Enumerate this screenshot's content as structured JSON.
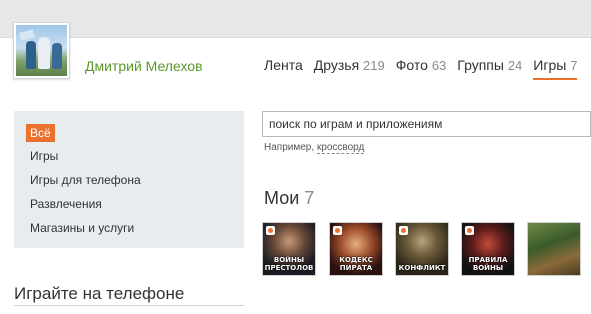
{
  "profile": {
    "name": "Дмитрий Мелехов"
  },
  "nav": {
    "tabs": [
      {
        "label": "Лента",
        "count": ""
      },
      {
        "label": "Друзья",
        "count": "219"
      },
      {
        "label": "Фото",
        "count": "63"
      },
      {
        "label": "Группы",
        "count": "24"
      },
      {
        "label": "Игры",
        "count": "7",
        "active": true
      }
    ]
  },
  "sidebar": {
    "items": [
      {
        "label": "Всё",
        "active": true
      },
      {
        "label": "Игры"
      },
      {
        "label": "Игры для телефона"
      },
      {
        "label": "Развлечения"
      },
      {
        "label": "Магазины и услуги"
      }
    ]
  },
  "phone_section": {
    "title": "Играйте на телефоне"
  },
  "search": {
    "value": "поиск по играм и приложениям",
    "hint_prefix": "Например,",
    "hint_link": "кроссворд"
  },
  "my_games": {
    "title": "Мои",
    "count": "7",
    "items": [
      {
        "caption": "ВОЙНЫ ПРЕСТОЛОВ"
      },
      {
        "caption": "КОДЕКС ПИРАТА"
      },
      {
        "caption": "КОНФЛИКТ"
      },
      {
        "caption": "ПРАВИЛА ВОЙНЫ"
      },
      {
        "caption": ""
      }
    ]
  },
  "colors": {
    "accent": "#eb722e",
    "username": "#5b9a2a",
    "sidebar_bg": "#e7ecef"
  }
}
